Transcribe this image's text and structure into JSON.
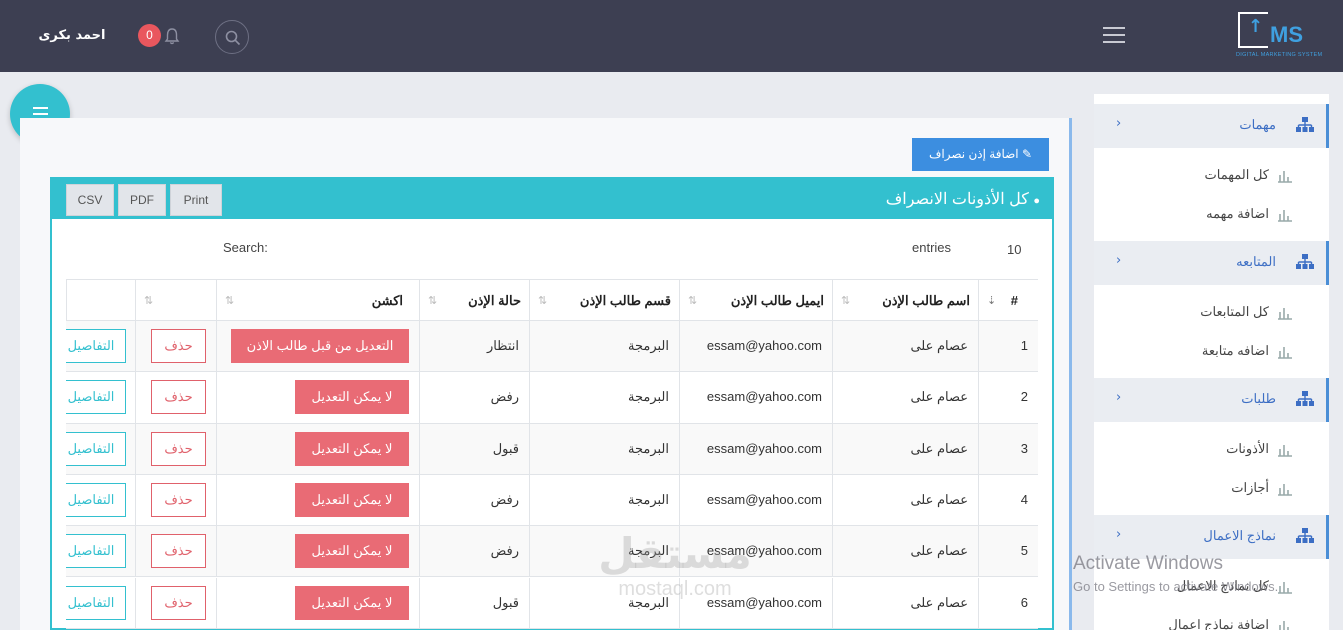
{
  "header": {
    "username": "احمد بكرى",
    "notification_count": "0",
    "logo_text": "MS",
    "logo_tagline": "DIGITAL MARKETING SYSTEM"
  },
  "sidebar": {
    "sections": [
      {
        "label": "مهمات",
        "items": [
          "كل المهمات",
          "اضافة مهمه"
        ]
      },
      {
        "label": "المتابعه",
        "items": [
          "كل المتابعات",
          "اضافه متابعة"
        ]
      },
      {
        "label": "طلبات",
        "items": [
          "الأذونات",
          "أجازات"
        ]
      },
      {
        "label": "نماذج الاعمال",
        "items": [
          "كل نماذج الاعمال",
          "اضافة نماذج اعمال"
        ]
      }
    ]
  },
  "toolbar": {
    "add_button": "اضافة إذن نصراف"
  },
  "panel": {
    "title": "كل الأذونات الانصراف",
    "export_buttons": [
      "Print",
      "PDF",
      "CSV"
    ],
    "entries_value": "10",
    "entries_label": "entries",
    "search_label": "Search:"
  },
  "table": {
    "columns": [
      "#",
      "اسم طالب الإذن",
      "ايميل طالب الإذن",
      "قسم طالب الإذن",
      "حالة الإذن",
      "اكشن"
    ],
    "delete_label": "حذف",
    "details_label": "التفاصيل",
    "rows": [
      {
        "num": "1",
        "name": "عصام على",
        "email": "essam@yahoo.com",
        "dept": "البرمجة",
        "status": "انتظار",
        "action": "التعديل من قبل طالب الاذن"
      },
      {
        "num": "2",
        "name": "عصام على",
        "email": "essam@yahoo.com",
        "dept": "البرمجة",
        "status": "رفض",
        "action": "لا يمكن التعديل"
      },
      {
        "num": "3",
        "name": "عصام على",
        "email": "essam@yahoo.com",
        "dept": "البرمجة",
        "status": "قبول",
        "action": "لا يمكن التعديل"
      },
      {
        "num": "4",
        "name": "عصام على",
        "email": "essam@yahoo.com",
        "dept": "البرمجة",
        "status": "رفض",
        "action": "لا يمكن التعديل"
      },
      {
        "num": "5",
        "name": "عصام على",
        "email": "essam@yahoo.com",
        "dept": "البرمجة",
        "status": "رفض",
        "action": "لا يمكن التعديل"
      },
      {
        "num": "6",
        "name": "عصام على",
        "email": "essam@yahoo.com",
        "dept": "البرمجة",
        "status": "قبول",
        "action": "لا يمكن التعديل"
      }
    ]
  },
  "watermarks": {
    "mostaql_ar": "مستقل",
    "mostaql_en": "mostaql.com",
    "activate_title": "Activate Windows",
    "activate_sub": "Go to Settings to activate Windows."
  },
  "colors": {
    "topbar": "#3d3f52",
    "teal": "#33c0cf",
    "primary_blue": "#3c8ee0",
    "danger": "#e96b75"
  }
}
